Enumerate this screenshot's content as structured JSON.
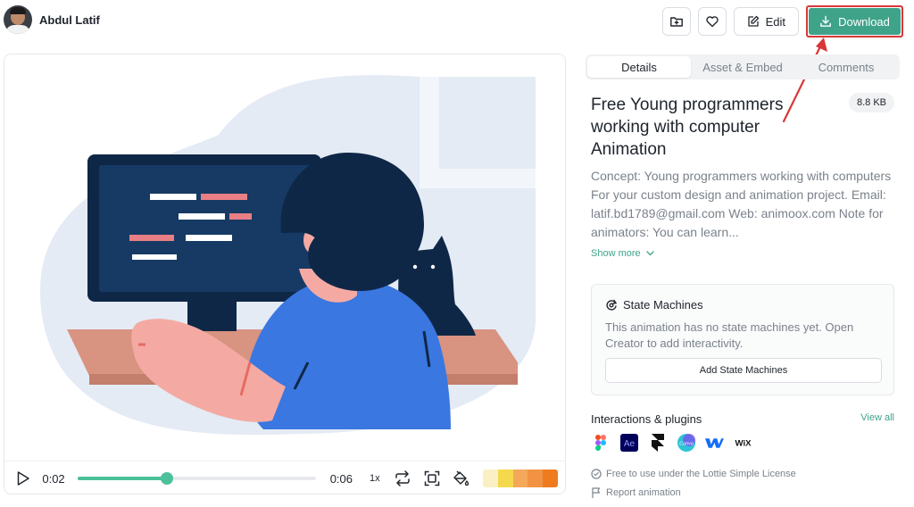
{
  "author": {
    "name": "Abdul Latif"
  },
  "header": {
    "edit_label": "Edit",
    "download_label": "Download"
  },
  "player": {
    "current_time": "0:02",
    "total_time": "0:06",
    "progress_fraction": 0.375,
    "speed": "1x",
    "palette": [
      "#fbf0c4",
      "#f5d94d",
      "#f4a85a",
      "#f29343",
      "#ef7b1f"
    ]
  },
  "tabs": [
    {
      "label": "Details",
      "active": true
    },
    {
      "label": "Asset & Embed",
      "active": false
    },
    {
      "label": "Comments",
      "active": false
    }
  ],
  "details": {
    "title": "Free Young programmers working with computer Animation",
    "file_size": "8.8 KB",
    "description": "Concept: Young programmers working with computers For your custom design and animation project. Email: latif.bd1789@gmail.com Web: animoox.com Note for animators: You can learn...",
    "show_more": "Show more"
  },
  "state_machines": {
    "title": "State Machines",
    "text": "This animation has no state machines yet. Open Creator to add interactivity.",
    "button": "Add State Machines"
  },
  "interactions": {
    "title": "Interactions & plugins",
    "view_all": "View all",
    "plugins": [
      "figma-icon",
      "after-effects-icon",
      "framer-icon",
      "canva-icon",
      "webflow-icon",
      "wix-icon"
    ],
    "ae_label": "Ae",
    "wix_label": "WiX",
    "canva_label": "Canva"
  },
  "license": {
    "text": "Free to use under the Lottie Simple License",
    "report": "Report animation"
  },
  "colors": {
    "accent": "#3fa38a",
    "highlight_border": "#d93636"
  }
}
